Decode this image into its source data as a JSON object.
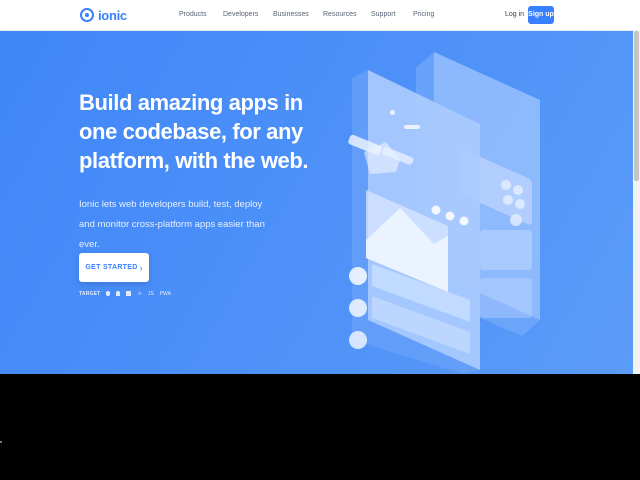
{
  "header": {
    "brand": "ionic",
    "nav": [
      "Products",
      "Developers",
      "Businesses",
      "Resources",
      "Support",
      "Pricing"
    ],
    "login_label": "Log in",
    "signup_label": "Sign up"
  },
  "hero": {
    "headline": "Build amazing apps in one codebase, for any platform, with the web.",
    "subheadline": "Ionic lets web developers build, test, deploy and monitor cross-platform apps easier than ever.",
    "cta_label": "GET STARTED",
    "targets_label": "TARGET",
    "target_icons": [
      "apple-icon",
      "android-icon",
      "windows-icon",
      "electron-icon",
      "js-icon",
      "pwa-icon"
    ],
    "target_texts": {
      "js": "JS",
      "pwa": "PWA"
    }
  },
  "colors": {
    "brand": "#3880ff",
    "hero_gradient_start": "#3f86f7",
    "hero_gradient_end": "#5b9cf9"
  }
}
